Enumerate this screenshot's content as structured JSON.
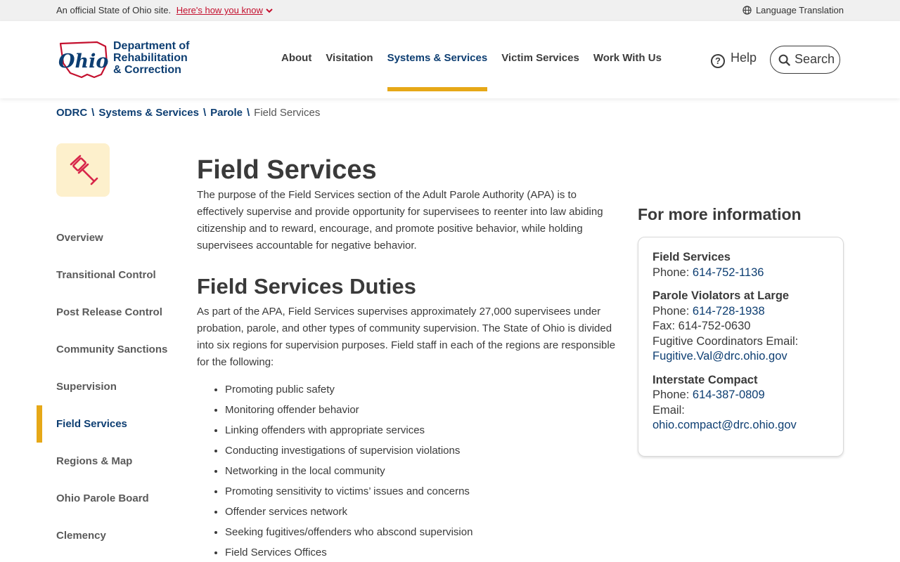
{
  "banner": {
    "official_text": "An official State of Ohio site.",
    "how_link": "Here's how you know",
    "language": "Language Translation"
  },
  "header": {
    "logo_lines": [
      "Department of",
      "Rehabilitation",
      "& Correction"
    ],
    "logo_word": "Ohio",
    "nav": [
      {
        "label": "About"
      },
      {
        "label": "Visitation"
      },
      {
        "label": "Systems & Services",
        "active": true
      },
      {
        "label": "Victim Services"
      },
      {
        "label": "Work With Us"
      }
    ],
    "help_label": "Help",
    "search_label": "Search"
  },
  "breadcrumb": {
    "items": [
      "ODRC",
      "Systems & Services",
      "Parole"
    ],
    "current": "Field Services"
  },
  "sidenav": {
    "items": [
      {
        "label": "Overview"
      },
      {
        "label": "Transitional Control"
      },
      {
        "label": "Post Release Control"
      },
      {
        "label": "Community Sanctions"
      },
      {
        "label": "Supervision"
      },
      {
        "label": "Field Services",
        "active": true
      },
      {
        "label": "Regions & Map"
      },
      {
        "label": "Ohio Parole Board"
      },
      {
        "label": "Clemency"
      }
    ]
  },
  "main": {
    "title": "Field Services",
    "intro": "The purpose of the Field Services section of the Adult Parole Authority (APA) is to effectively supervise and provide opportunity for supervisees to reenter into law abiding citizenship and to reward, encourage, and promote positive behavior, while holding supervisees accountable for negative behavior.",
    "duties_title": "Field Services Duties",
    "duties_text": "As part of the APA, Field Services supervises approximately 27,000 supervisees under probation, parole, and other types of community supervision. The State of Ohio is divided into six regions for supervision purposes. Field staff in each of the regions are responsible for the following:",
    "duties": [
      "Promoting public safety",
      "Monitoring offender behavior",
      "Linking offenders with appropriate services",
      "Conducting investigations of supervision violations",
      "Networking in the local community",
      "Promoting sensitivity to victims’ issues and concerns",
      "Offender services network",
      "Seeking fugitives/offenders who abscond supervision",
      "Field Services Offices"
    ]
  },
  "info": {
    "title": "For more information",
    "field_services": {
      "name": "Field Services",
      "phone_label": "Phone: ",
      "phone": "614-752-1136"
    },
    "pval": {
      "name": "Parole Violators at Large",
      "phone_label": "Phone: ",
      "phone": "614-728-1938",
      "fax": "Fax: 614-752-0630",
      "email_label": "Fugitive Coordinators Email:",
      "email": "Fugitive.Val@drc.ohio.gov"
    },
    "compact": {
      "name": "Interstate Compact",
      "phone_label": "Phone: ",
      "phone": "614-387-0809",
      "email_label": "Email:",
      "email": "ohio.compact@drc.ohio.gov"
    }
  },
  "colors": {
    "brand_blue": "#0d3e72",
    "accent_gold": "#e6a817",
    "ohio_red": "#c4102e",
    "tile_bg": "#fdf0cc"
  },
  "icons": [
    "chevron-down-icon",
    "globe-icon",
    "help-icon",
    "search-icon",
    "gavel-icon"
  ]
}
